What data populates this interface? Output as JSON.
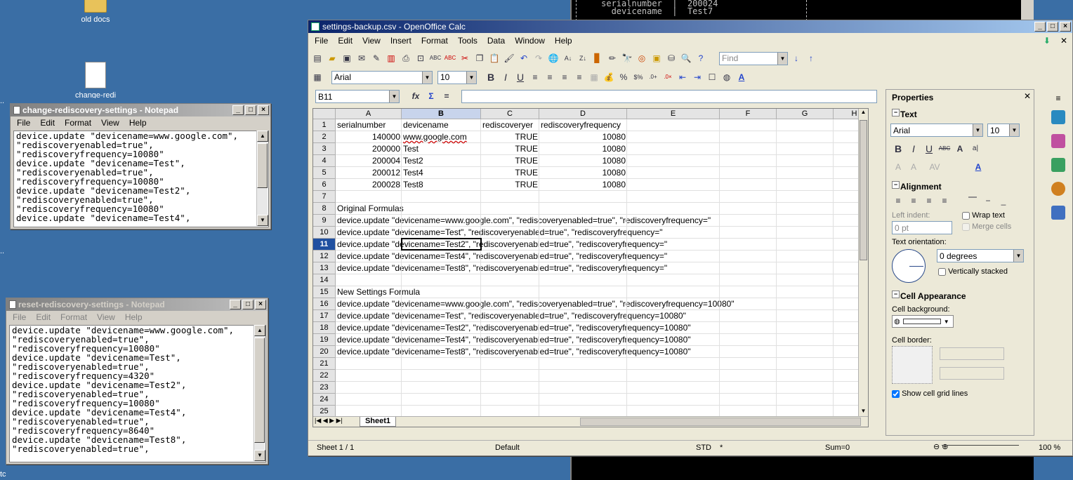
{
  "desktop": {
    "icons": [
      {
        "label": "old docs"
      },
      {
        "label": "change-redi"
      }
    ],
    "edge_labels": [
      "..",
      "..",
      "..",
      "tc"
    ]
  },
  "console": {
    "lines": [
      "     serialnumber  |  200024",
      "       devicename  |  Test7"
    ]
  },
  "notepad1": {
    "title": "change-rediscovery-settings - Notepad",
    "menu": [
      "File",
      "Edit",
      "Format",
      "View",
      "Help"
    ],
    "text": "device.update \"devicename=www.google.com\",\n\"rediscoveryenabled=true\",\n\"rediscoveryfrequency=10080\"\ndevice.update \"devicename=Test\",\n\"rediscoveryenabled=true\",\n\"rediscoveryfrequency=10080\"\ndevice.update \"devicename=Test2\",\n\"rediscoveryenabled=true\",\n\"rediscoveryfrequency=10080\"\ndevice.update \"devicename=Test4\","
  },
  "notepad2": {
    "title": "reset-rediscovery-settings - Notepad",
    "menu": [
      "File",
      "Edit",
      "Format",
      "View",
      "Help"
    ],
    "text": "device.update \"devicename=www.google.com\",\n\"rediscoveryenabled=true\",\n\"rediscoveryfrequency=10080\"\ndevice.update \"devicename=Test\",\n\"rediscoveryenabled=true\",\n\"rediscoveryfrequency=4320\"\ndevice.update \"devicename=Test2\",\n\"rediscoveryenabled=true\",\n\"rediscoveryfrequency=10080\"\ndevice.update \"devicename=Test4\",\n\"rediscoveryenabled=true\",\n\"rediscoveryfrequency=8640\"\ndevice.update \"devicename=Test8\",\n\"rediscoveryenabled=true\","
  },
  "calc": {
    "title": "settings-backup.csv - OpenOffice Calc",
    "menu": [
      "File",
      "Edit",
      "View",
      "Insert",
      "Format",
      "Tools",
      "Data",
      "Window",
      "Help"
    ],
    "find_placeholder": "Find",
    "font_name": "Arial",
    "font_size": "10",
    "name_box": "B11",
    "columns": [
      "A",
      "B",
      "C",
      "D",
      "E",
      "F",
      "G",
      "H"
    ],
    "rows": [
      {
        "n": "1",
        "a": "serialnumber",
        "b": "devicename",
        "c": "rediscoveryer",
        "d": "rediscoveryfrequency"
      },
      {
        "n": "2",
        "a": "140000",
        "b": "www.google.com",
        "c": "TRUE",
        "d": "10080"
      },
      {
        "n": "3",
        "a": "200000",
        "b": "Test",
        "c": "TRUE",
        "d": "10080"
      },
      {
        "n": "4",
        "a": "200004",
        "b": "Test2",
        "c": "TRUE",
        "d": "10080"
      },
      {
        "n": "5",
        "a": "200012",
        "b": "Test4",
        "c": "TRUE",
        "d": "10080"
      },
      {
        "n": "6",
        "a": "200028",
        "b": "Test8",
        "c": "TRUE",
        "d": "10080"
      },
      {
        "n": "7",
        "text": ""
      },
      {
        "n": "8",
        "text": "Original Formulas"
      },
      {
        "n": "9",
        "text": "device.update \"devicename=www.google.com\", \"rediscoveryenabled=true\", \"rediscoveryfrequency=\""
      },
      {
        "n": "10",
        "text": "device.update \"devicename=Test\", \"rediscoveryenabled=true\", \"rediscoveryfrequency=\""
      },
      {
        "n": "11",
        "text": "device.update \"devicename=Test2\", \"rediscoveryenabled=true\", \"rediscoveryfrequency=\""
      },
      {
        "n": "12",
        "text": "device.update \"devicename=Test4\", \"rediscoveryenabled=true\", \"rediscoveryfrequency=\""
      },
      {
        "n": "13",
        "text": "device.update \"devicename=Test8\", \"rediscoveryenabled=true\", \"rediscoveryfrequency=\""
      },
      {
        "n": "14",
        "text": ""
      },
      {
        "n": "15",
        "text": "New Settings Formula"
      },
      {
        "n": "16",
        "text": "device.update \"devicename=www.google.com\", \"rediscoveryenabled=true\", \"rediscoveryfrequency=10080\""
      },
      {
        "n": "17",
        "text": "device.update \"devicename=Test\", \"rediscoveryenabled=true\", \"rediscoveryfrequency=10080\""
      },
      {
        "n": "18",
        "text": "device.update \"devicename=Test2\", \"rediscoveryenabled=true\", \"rediscoveryfrequency=10080\""
      },
      {
        "n": "19",
        "text": "device.update \"devicename=Test4\", \"rediscoveryenabled=true\", \"rediscoveryfrequency=10080\""
      },
      {
        "n": "20",
        "text": "device.update \"devicename=Test8\", \"rediscoveryenabled=true\", \"rediscoveryfrequency=10080\""
      },
      {
        "n": "21",
        "text": ""
      },
      {
        "n": "22",
        "text": ""
      },
      {
        "n": "23",
        "text": ""
      },
      {
        "n": "24",
        "text": ""
      },
      {
        "n": "25",
        "text": ""
      },
      {
        "n": "26",
        "text": ""
      }
    ],
    "sheet_tab": "Sheet1",
    "status": {
      "sheet": "Sheet 1 / 1",
      "style": "Default",
      "mode": "STD",
      "modified": "*",
      "sum": "Sum=0",
      "zoom": "100 %"
    }
  },
  "properties": {
    "title": "Properties",
    "text_section": "Text",
    "font_name": "Arial",
    "font_size": "10",
    "alignment_section": "Alignment",
    "left_indent_label": "Left indent:",
    "left_indent_value": "0 pt",
    "wrap_text": "Wrap text",
    "merge_cells": "Merge cells",
    "text_orientation_label": "Text orientation:",
    "orientation_value": "0 degrees",
    "vertically_stacked": "Vertically stacked",
    "cell_appearance_section": "Cell Appearance",
    "cell_background_label": "Cell background:",
    "cell_border_label": "Cell border:",
    "show_grid": "Show cell grid lines"
  }
}
